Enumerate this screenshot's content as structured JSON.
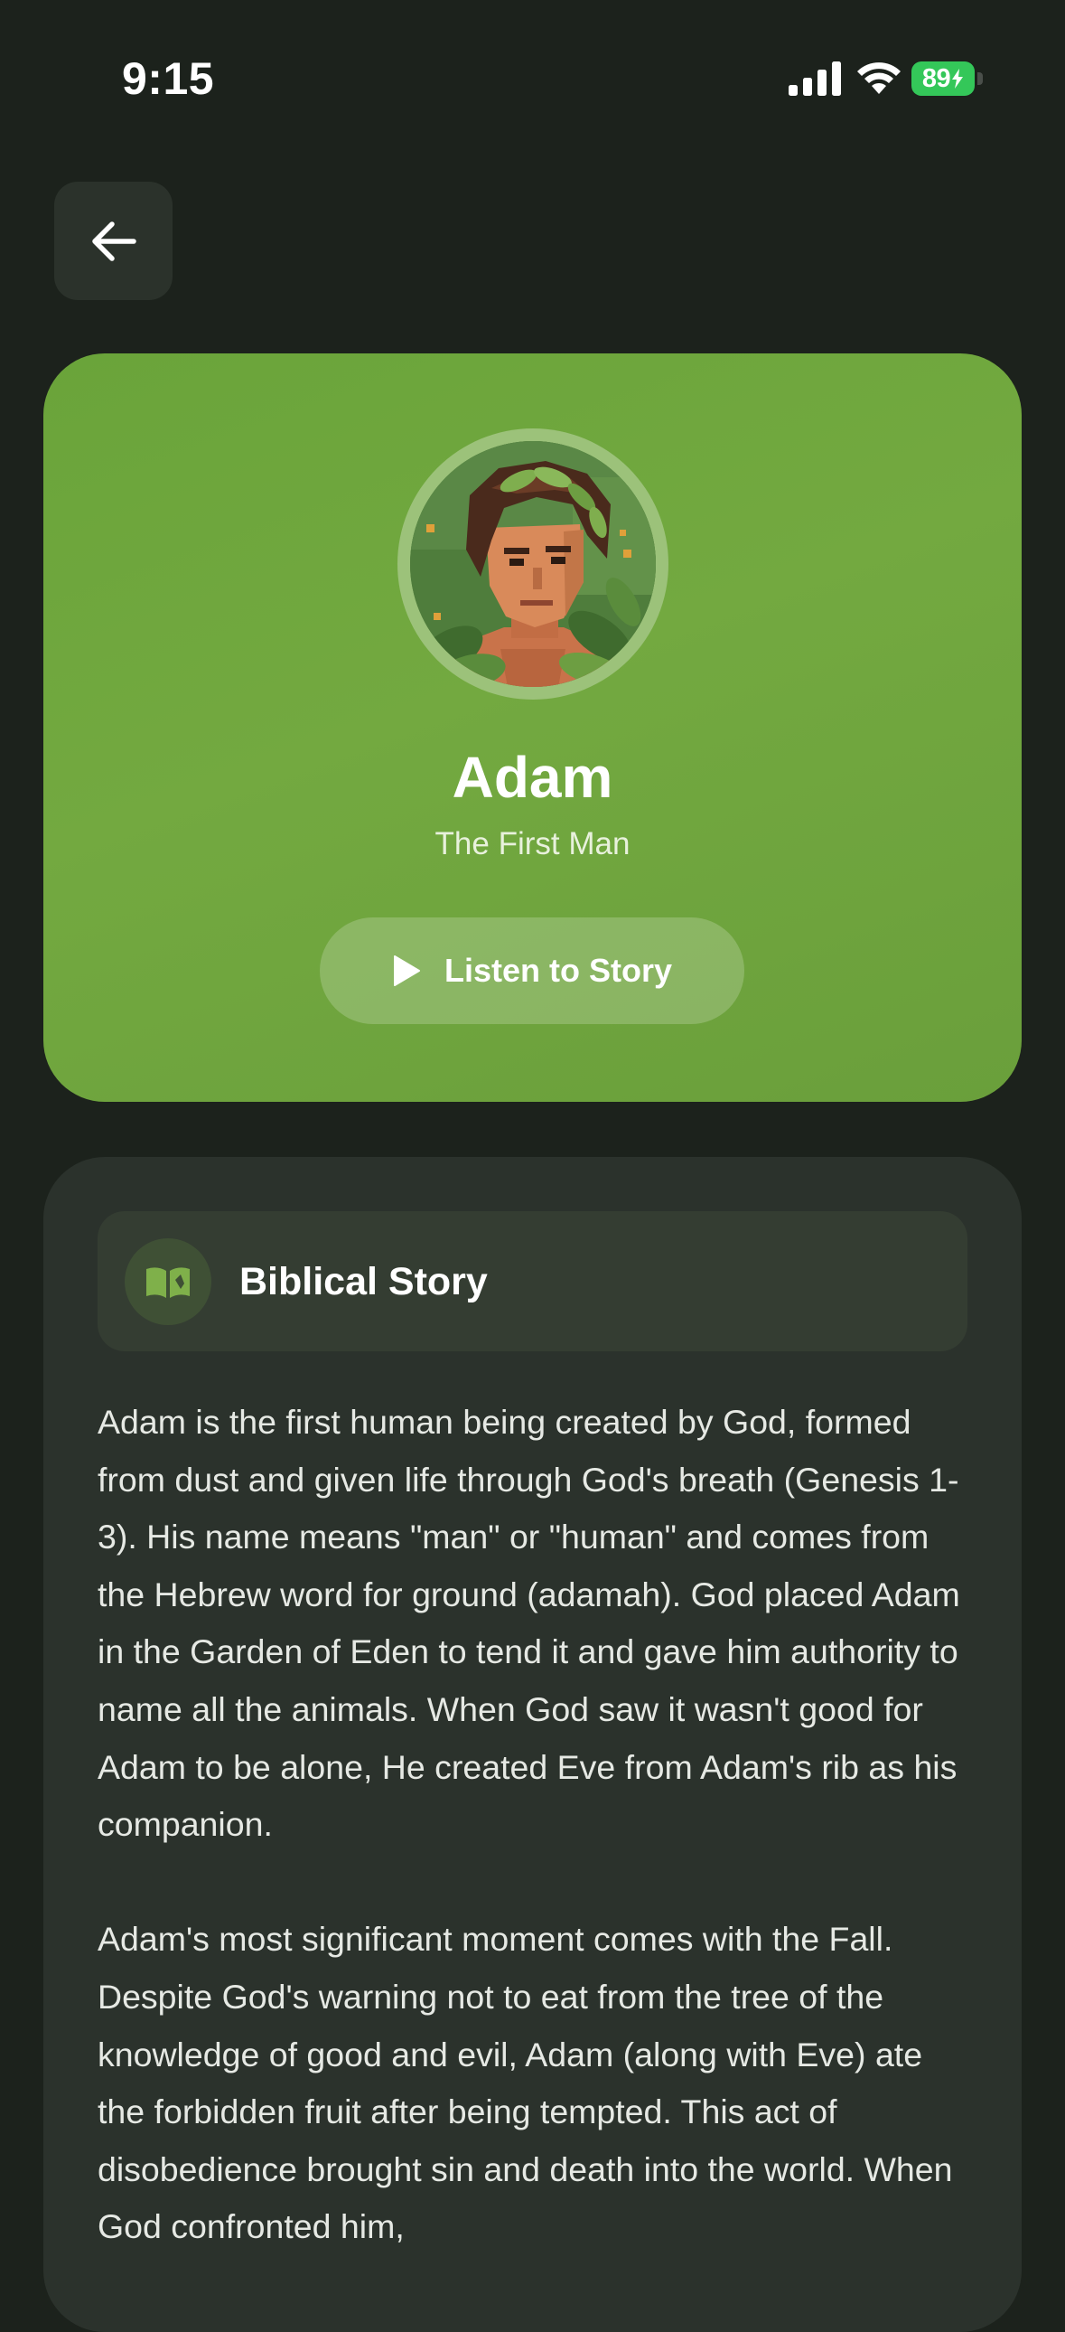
{
  "status_bar": {
    "time": "9:15",
    "battery_level": "89"
  },
  "icons": {
    "back": "arrow-left-icon",
    "signal": "cellular-signal-icon",
    "wifi": "wifi-icon",
    "battery": "battery-charging-icon",
    "play": "play-icon",
    "book": "open-book-icon"
  },
  "hero": {
    "name": "Adam",
    "subtitle": "The First Man",
    "listen_label": "Listen to Story",
    "avatar": "adam-portrait-avatar"
  },
  "story": {
    "header_title": "Biblical Story",
    "paragraphs": [
      "Adam is the first human being created by God, formed from dust and given life through God's breath (Genesis 1-3). His name means \"man\" or \"human\" and comes from the Hebrew word for ground (adamah). God placed Adam in the Garden of Eden to tend it and gave him authority to name all the animals. When God saw it wasn't good for Adam to be alone, He created Eve from Adam's rib as his companion.",
      "Adam's most significant moment comes with the Fall. Despite God's warning not to eat from the tree of the knowledge of good and evil, Adam (along with Eve) ate the forbidden fruit after being tempted. This act of disobedience brought sin and death into the world. When God confronted him,"
    ]
  },
  "colors": {
    "background": "#1c221c",
    "hero_green": "#6fa63d",
    "card": "#2b322c",
    "battery_green": "#34c759"
  }
}
